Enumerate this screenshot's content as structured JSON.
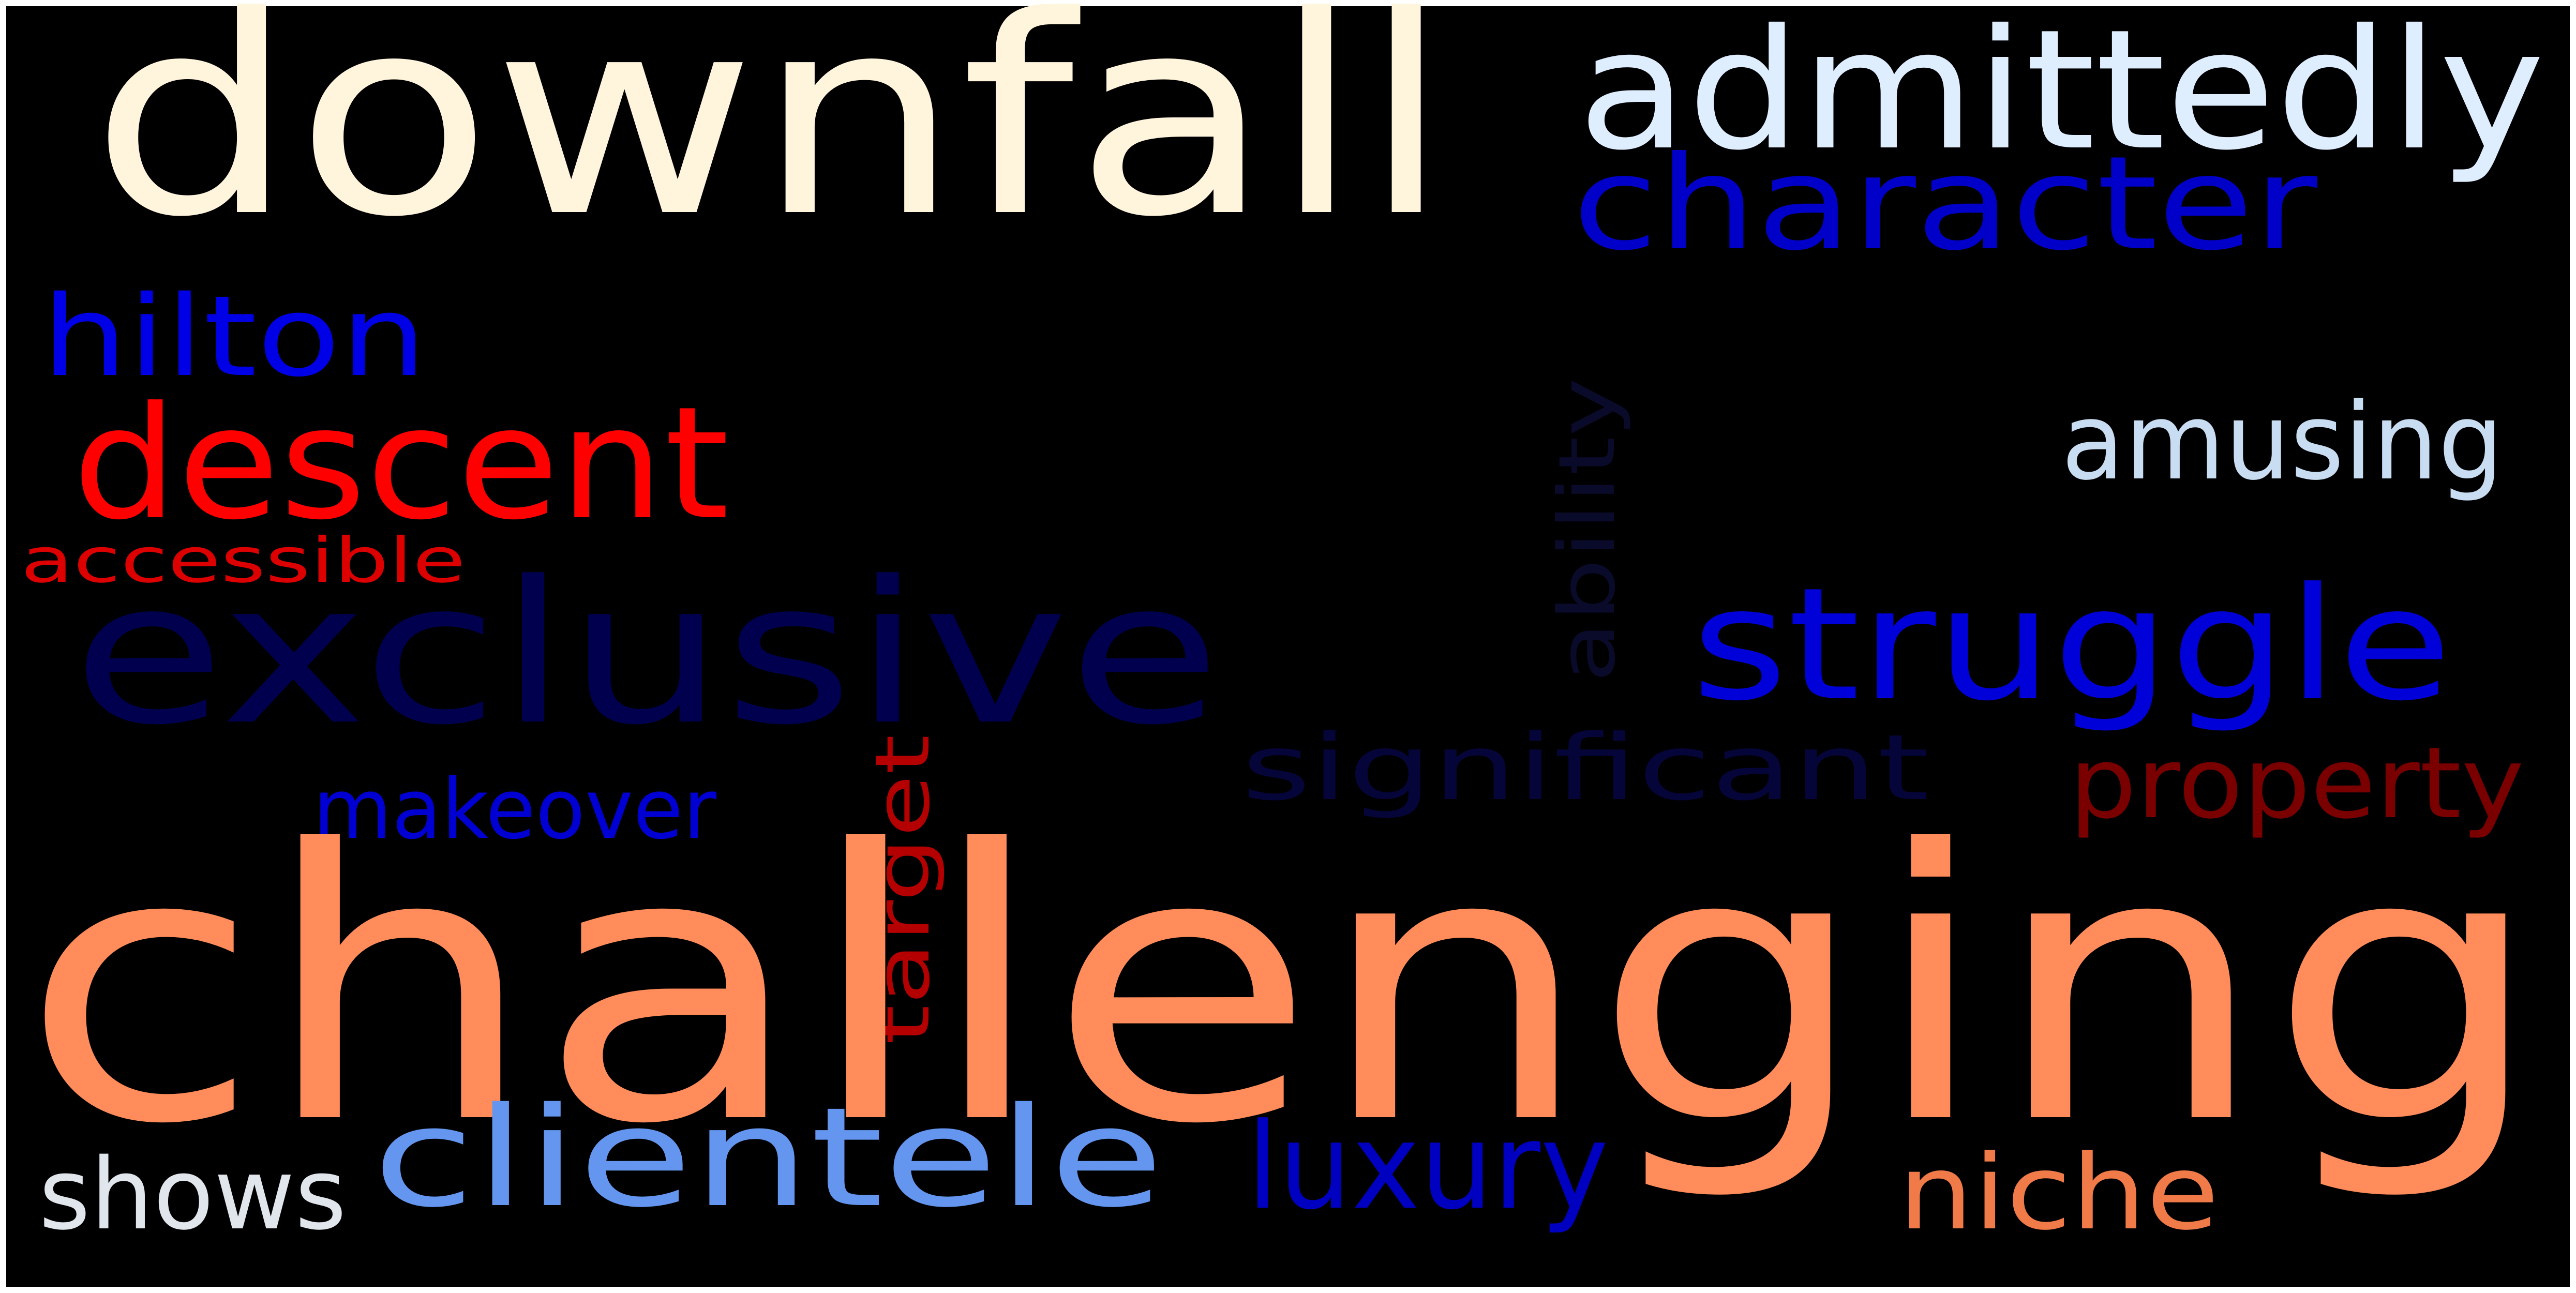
{
  "background_color": "#000000",
  "frame_color": "#ffffff",
  "words": {
    "downfall": {
      "text": "downfall",
      "color": "#fff4dc"
    },
    "admittedly": {
      "text": "admittedly",
      "color": "#dfeeff"
    },
    "character": {
      "text": "character",
      "color": "#0000c8"
    },
    "hilton": {
      "text": "hilton",
      "color": "#0000e6"
    },
    "descent": {
      "text": "descent",
      "color": "#ff0000"
    },
    "amusing": {
      "text": "amusing",
      "color": "#c8ddf2"
    },
    "ability": {
      "text": "ability",
      "color": "#0a0a2a"
    },
    "accessible": {
      "text": "accessible",
      "color": "#dc0000"
    },
    "exclusive": {
      "text": "exclusive",
      "color": "#00004e"
    },
    "struggle": {
      "text": "struggle",
      "color": "#0000d8"
    },
    "significant": {
      "text": "significant",
      "color": "#05053a"
    },
    "property": {
      "text": "property",
      "color": "#7a0000"
    },
    "makeover": {
      "text": "makeover",
      "color": "#0000d2"
    },
    "target": {
      "text": "target",
      "color": "#b40000"
    },
    "challenging": {
      "text": "challenging",
      "color": "#ff8c5a"
    },
    "clientele": {
      "text": "clientele",
      "color": "#6496f0"
    },
    "luxury": {
      "text": "luxury",
      "color": "#0000c0"
    },
    "shows": {
      "text": "shows",
      "color": "#e0e6ec"
    },
    "niche": {
      "text": "niche",
      "color": "#f07a48"
    }
  }
}
